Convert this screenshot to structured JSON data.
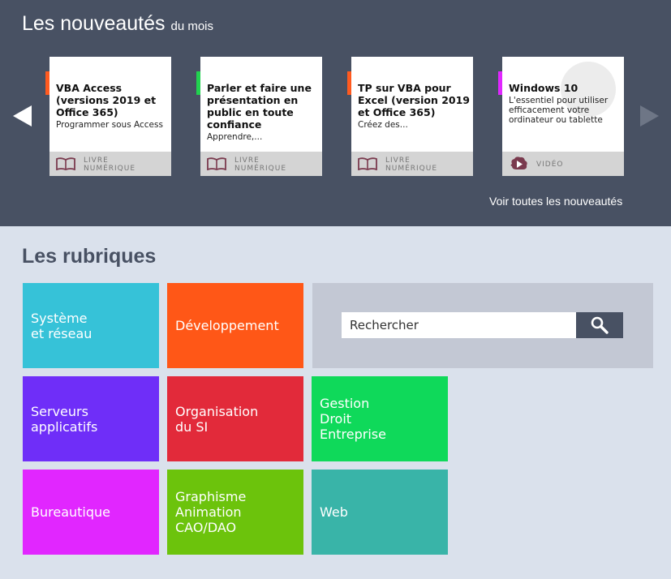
{
  "news": {
    "title": "Les nouveautés",
    "title_suffix": "du mois",
    "see_all": "Voir toutes les nouveautés",
    "cards": [
      {
        "title": "VBA Access (versions 2019 et Office 365)",
        "desc": "Programmer sous Access",
        "format": "LIVRE\nNUMÉRIQUE",
        "format_icon": "book-icon",
        "accent": "#ff5a1f"
      },
      {
        "title": "Parler et faire une présentation en public en toute confiance",
        "desc": "Apprendre,...",
        "format": "LIVRE\nNUMÉRIQUE",
        "format_icon": "book-icon",
        "accent": "#21d24f"
      },
      {
        "title": "TP sur VBA pour Excel (version 2019 et Office 365)",
        "desc": "Créez des...",
        "format": "LIVRE\nNUMÉRIQUE",
        "format_icon": "book-icon",
        "accent": "#ff5a1f"
      },
      {
        "title": "Windows 10",
        "desc": "L'essentiel pour utiliser efficacement votre ordinateur ou tablette",
        "format": "VIDÉO",
        "format_icon": "video-icon",
        "accent": "#e026ff"
      }
    ]
  },
  "rubriques": {
    "title": "Les rubriques",
    "search_placeholder": "Rechercher",
    "tiles": [
      {
        "label": "Système\net réseau",
        "color": "#36c2d8"
      },
      {
        "label": "Développement",
        "color": "#ff5717"
      },
      {
        "label": "Serveurs\napplicatifs",
        "color": "#6f2ef8"
      },
      {
        "label": "Organisation\ndu SI",
        "color": "#e22a3a"
      },
      {
        "label": "Gestion\nDroit\nEntreprise",
        "color": "#0fd95a"
      },
      {
        "label": "Bureautique",
        "color": "#e126ff"
      },
      {
        "label": "Graphisme\nAnimation\nCAO/DAO",
        "color": "#6cc30c"
      },
      {
        "label": "Web",
        "color": "#39b4a8"
      }
    ]
  },
  "colors": {
    "header_bg": "#485163",
    "page_bg": "#dae1ec",
    "search_panel_bg": "#c3c8d4"
  }
}
